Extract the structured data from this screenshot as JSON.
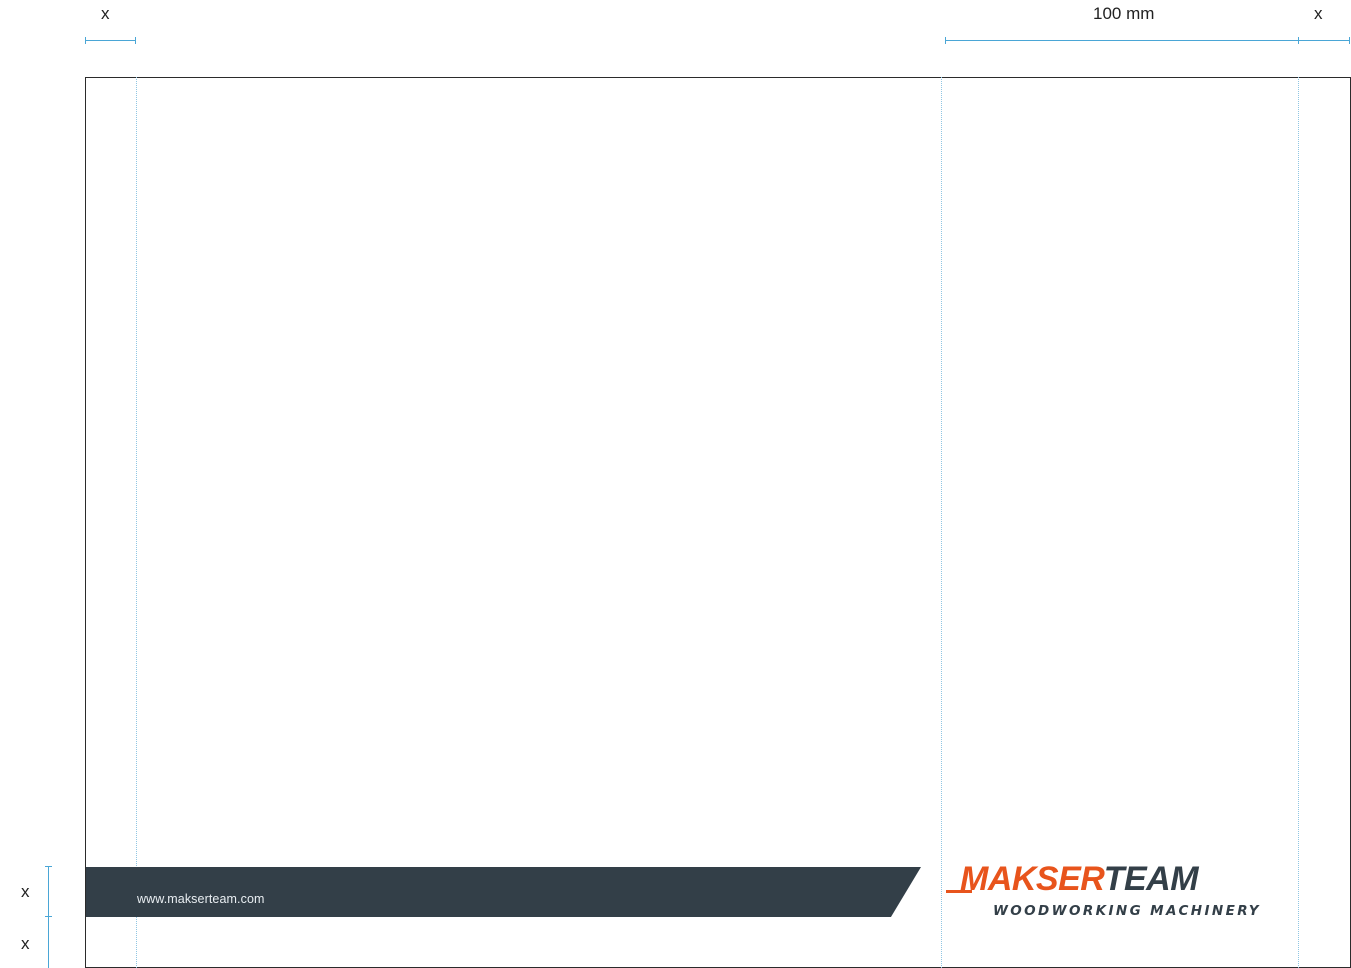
{
  "dimensions": {
    "top_left_label": "x",
    "top_width_label": "100 mm",
    "top_right_label": "x",
    "bottom_label_1": "x",
    "bottom_label_2": "x"
  },
  "footer": {
    "url": "www.makserteam.com"
  },
  "logo": {
    "word_part_1": "MAKSER",
    "word_part_2": "TEAM",
    "tagline": "WOODWORKING MACHINERY",
    "colors": {
      "orange": "#e8541c",
      "navy": "#333f48"
    }
  },
  "colors": {
    "footer_band": "#333f48",
    "guides": "#8fc6e3",
    "dimension_lines": "#4aa6d6"
  }
}
